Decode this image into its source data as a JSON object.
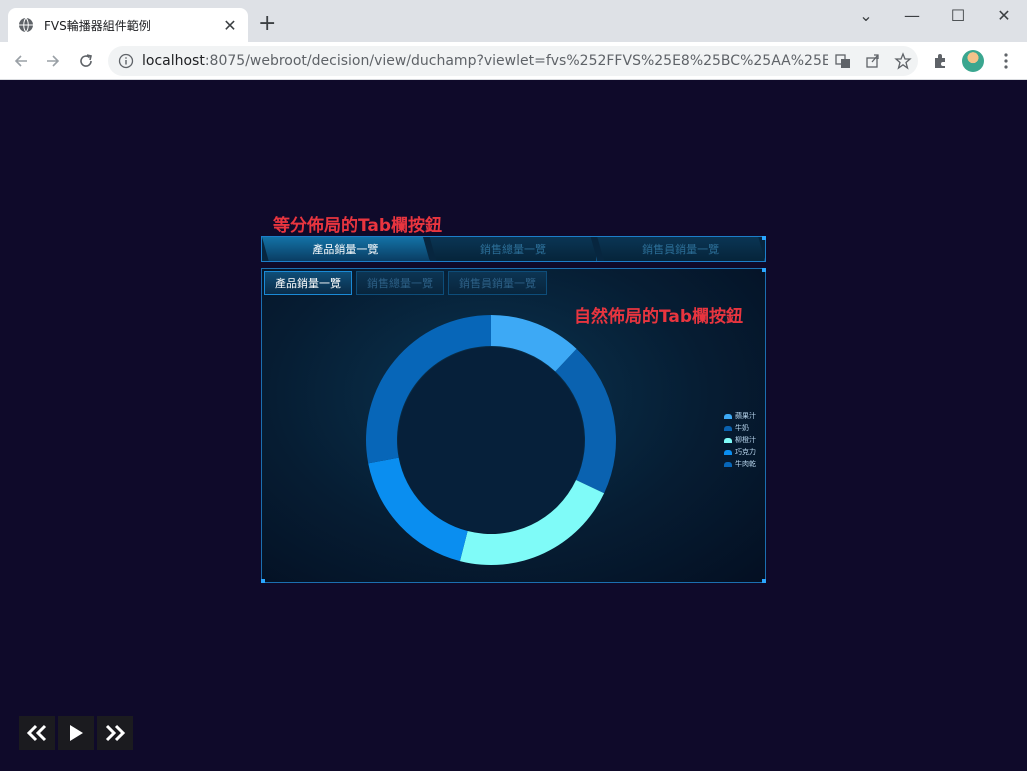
{
  "browser": {
    "tab_title": "FVS輪播器組件範例",
    "url_host": "localhost",
    "url_path": ":8075/webroot/decision/view/duchamp?viewlet=fvs%252FFVS%25E8%25BC%25AA%25E6...",
    "window_controls": [
      "chevron-down-icon",
      "minimize-icon",
      "maximize-icon",
      "close-icon"
    ]
  },
  "annotations": {
    "equal_layout": "等分佈局的Tab欄按鈕",
    "natural_layout": "自然佈局的Tab欄按鈕"
  },
  "outer_tabs": [
    {
      "label": "產品銷量一覽",
      "active": true
    },
    {
      "label": "銷售總量一覽",
      "active": false
    },
    {
      "label": "銷售員銷量一覽",
      "active": false
    }
  ],
  "inner_tabs": [
    {
      "label": "產品銷量一覽",
      "active": true
    },
    {
      "label": "銷售總量一覽",
      "active": false
    },
    {
      "label": "銷售員銷量一覽",
      "active": false
    }
  ],
  "colors": {
    "page_bg": "#0f0a2a",
    "accent_red": "#e8353f",
    "series": [
      "#3da9f5",
      "#0a62b0",
      "#7ffbf8",
      "#0a8ef0",
      "#0766b8"
    ]
  },
  "chart_data": {
    "type": "pie",
    "donut": true,
    "legend_position": "right",
    "categories": [
      "蘋果汁",
      "牛奶",
      "柳橙汁",
      "巧克力",
      "牛肉乾"
    ],
    "values": [
      12,
      20,
      22,
      18,
      28
    ],
    "start_angle_deg": 0
  },
  "playback": {
    "controls": [
      "rewind-icon",
      "play-icon",
      "fast-forward-icon"
    ]
  }
}
